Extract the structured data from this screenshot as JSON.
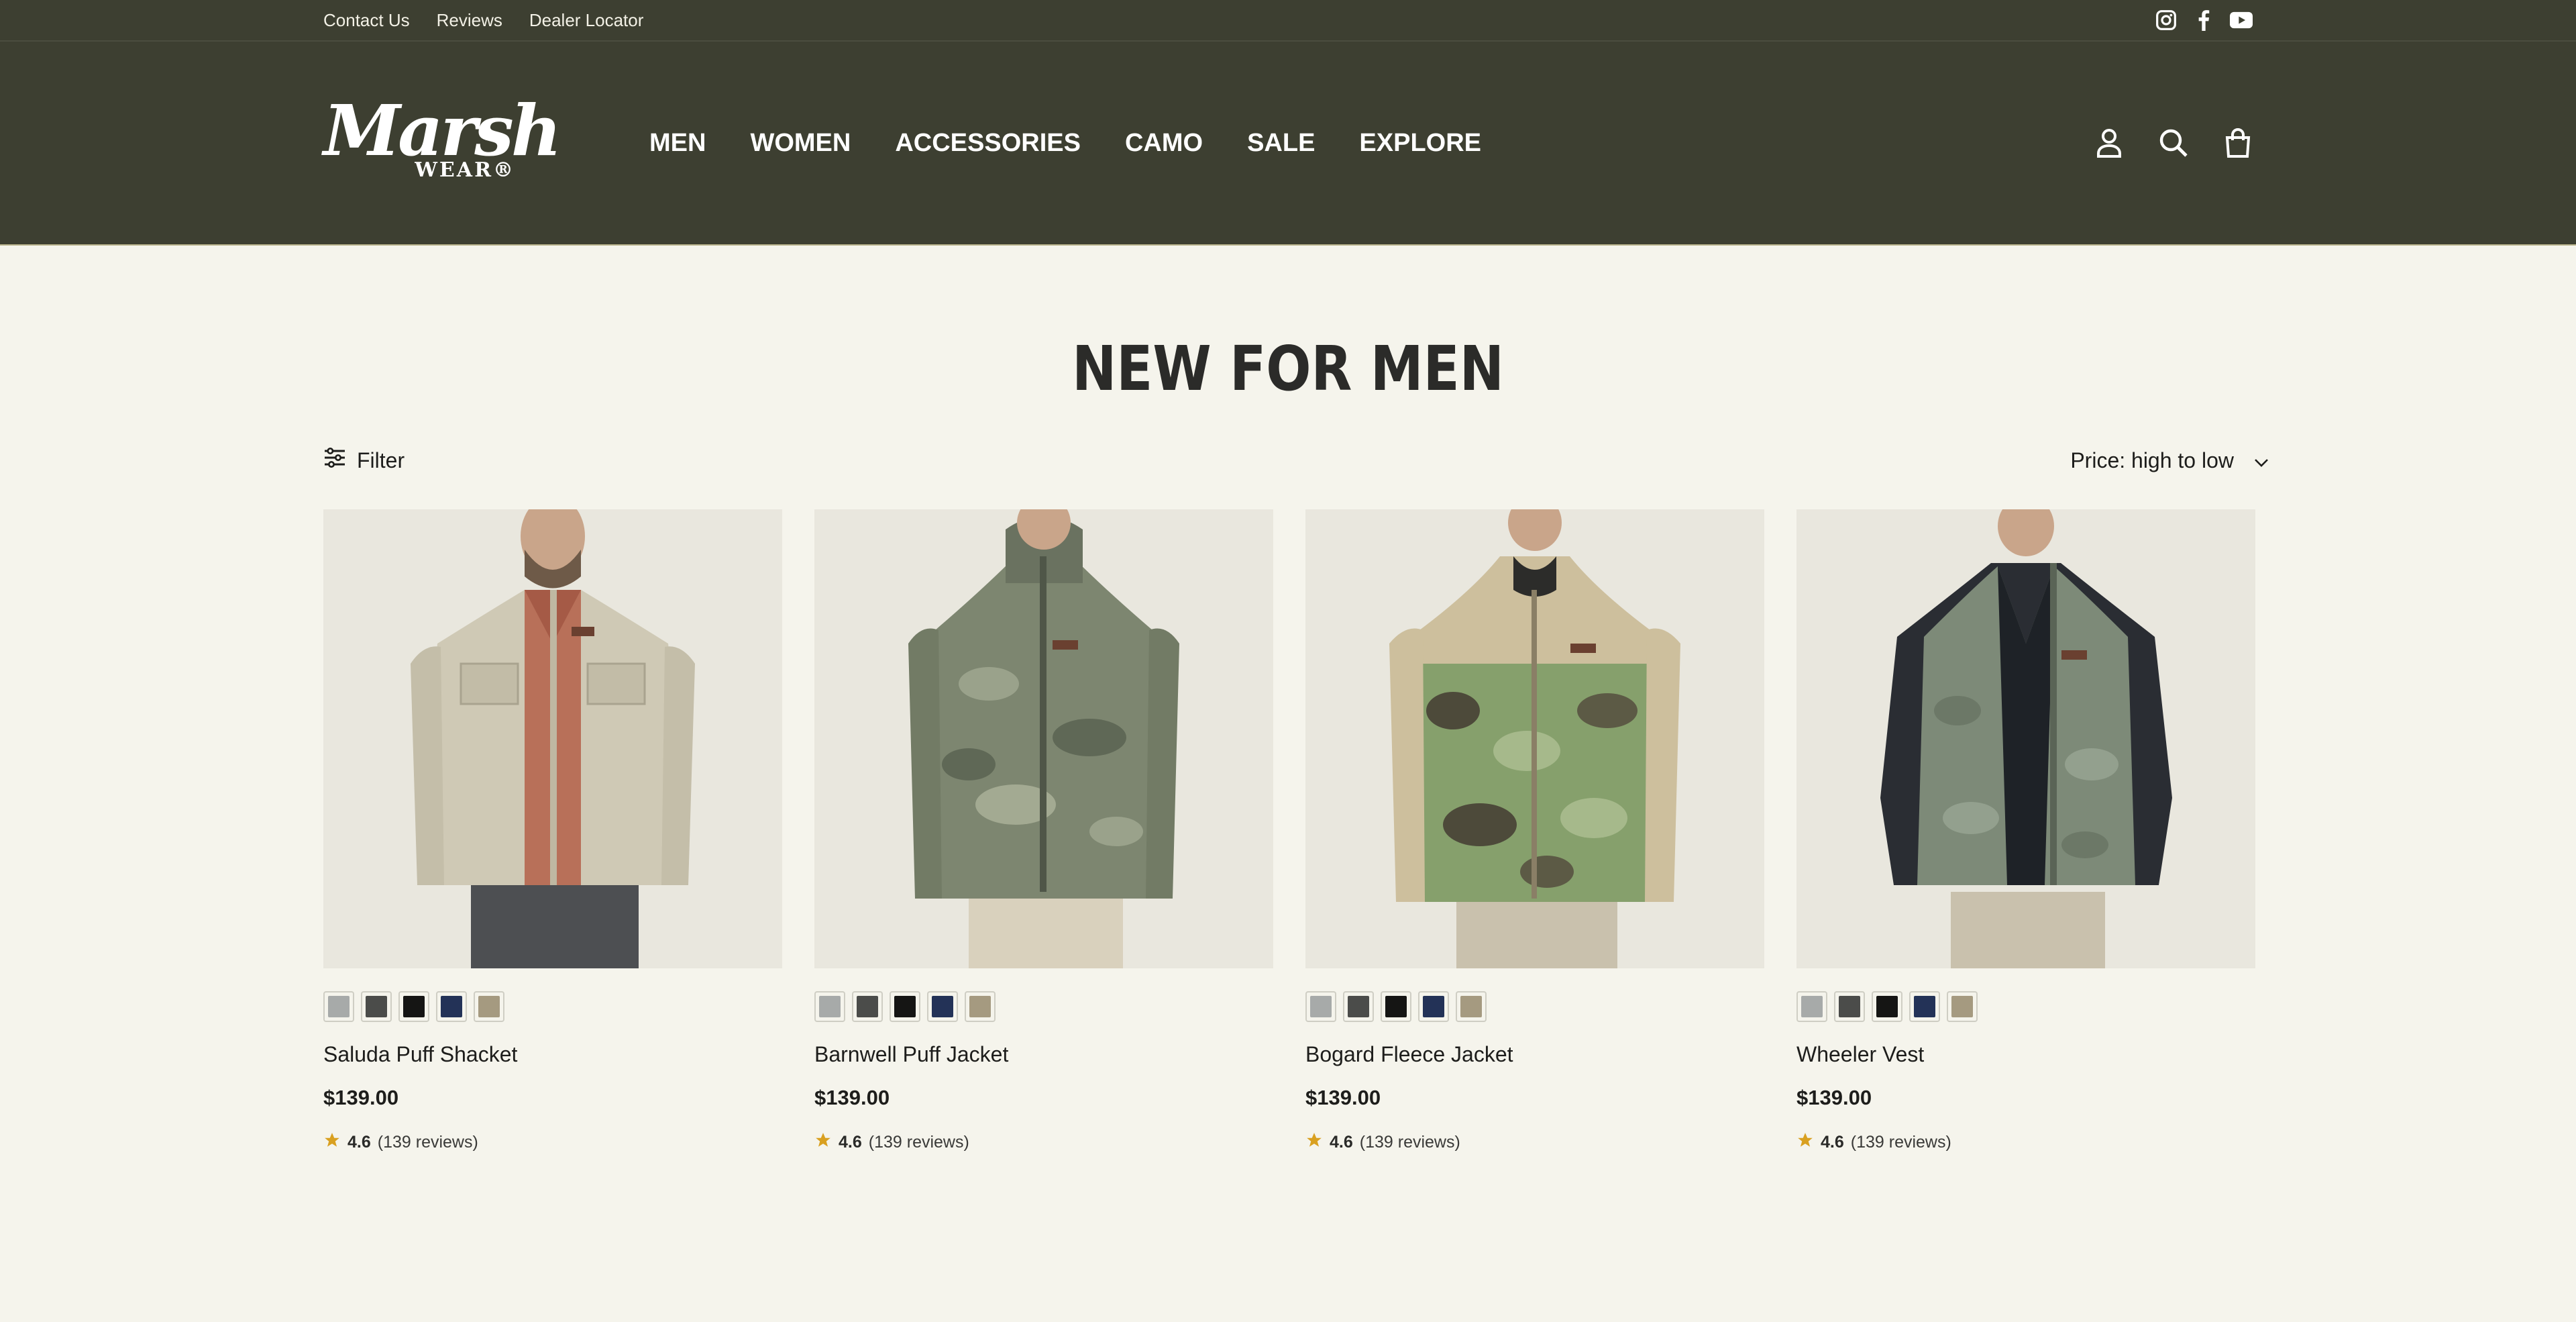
{
  "utility_bar": {
    "links": [
      "Contact Us",
      "Reviews",
      "Dealer Locator"
    ],
    "social_icons": [
      "instagram-icon",
      "facebook-icon",
      "youtube-icon"
    ]
  },
  "header": {
    "logo_script": "Marsh",
    "logo_sub": "WEAR®",
    "nav": [
      "MEN",
      "WOMEN",
      "ACCESSORIES",
      "CAMO",
      "SALE",
      "EXPLORE"
    ],
    "icons": [
      "account-icon",
      "search-icon",
      "cart-icon"
    ]
  },
  "page": {
    "title": "NEW FOR MEN",
    "filter_label": "Filter",
    "sort_label": "Price: high to low"
  },
  "swatch_colors": [
    "#a7aaa9",
    "#4b4c4a",
    "#151514",
    "#233257",
    "#a59a80"
  ],
  "products": [
    {
      "name": "Saluda Puff Shacket",
      "price": "$139.00",
      "rating": "4.6",
      "reviews": "(139 reviews)",
      "garment_color": "#cfc9b5",
      "accent": "#b06a55"
    },
    {
      "name": "Barnwell Puff Jacket",
      "price": "$139.00",
      "rating": "4.6",
      "reviews": "(139 reviews)",
      "garment_color": "#7d8670",
      "accent": "#6a7060"
    },
    {
      "name": "Bogard Fleece Jacket",
      "price": "$139.00",
      "rating": "4.6",
      "reviews": "(139 reviews)",
      "garment_color": "#86a06c",
      "accent": "#cdbf9d"
    },
    {
      "name": "Wheeler Vest",
      "price": "$139.00",
      "rating": "4.6",
      "reviews": "(139 reviews)",
      "garment_color": "#7d8a78",
      "accent": "#2a2d33"
    }
  ],
  "colors": {
    "header_bg": "#3d3f31",
    "page_bg": "#f5f4ec",
    "star": "#d9a020"
  }
}
